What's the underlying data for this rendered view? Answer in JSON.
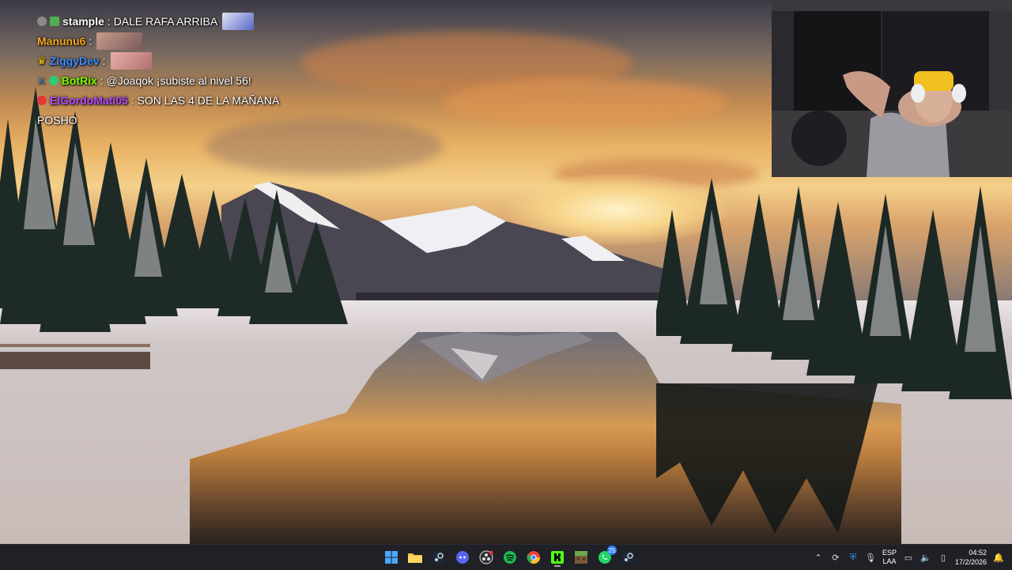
{
  "chat": {
    "messages": [
      {
        "user": "stample",
        "user_color": "#ffffff",
        "text": ": DALE RAFA ARRIBA",
        "badges": [
          "#8a8a8a",
          "#4caf50"
        ],
        "emote_colors": [
          "#5a66c8",
          "#dfe5f4"
        ]
      },
      {
        "user": "Manunu6",
        "user_color": "#f5a623",
        "text": ":",
        "badges": [],
        "emote_colors": [
          "#7a5c5c",
          "#c99a8a"
        ]
      },
      {
        "user": "ZiggyDev",
        "user_color": "#3c8cff",
        "text": ":",
        "badges": [
          "#f5c518"
        ],
        "emote_colors": [
          "#e8b0a8",
          "#b07070"
        ]
      },
      {
        "user": "BotRix",
        "user_color": "#7cfc00",
        "text": ": @Joaqok ¡subiste al nivel 56!",
        "badges": [
          "#2196f3",
          "#2ecc71"
        ],
        "emote_colors": []
      },
      {
        "user": "ElGordoMati05",
        "user_color": "#b24cff",
        "text": ": SON LAS 4 DE LA MAÑANA",
        "badges": [
          "#e53935"
        ],
        "emote_colors": []
      },
      {
        "user": "",
        "user_color": "#ffffff",
        "text": "POSHO",
        "badges": [],
        "emote_colors": []
      }
    ]
  },
  "taskbar": {
    "apps": [
      {
        "name": "start-button",
        "icon": "windows-icon",
        "color": "#4aa8ff"
      },
      {
        "name": "file-explorer",
        "icon": "folder-icon",
        "color": "#f5c242"
      },
      {
        "name": "steam",
        "icon": "steam-icon",
        "color": "#c7d5e0"
      },
      {
        "name": "discord",
        "icon": "discord-icon",
        "color": "#7289da"
      },
      {
        "name": "obs",
        "icon": "obs-icon",
        "color": "#dddddd"
      },
      {
        "name": "spotify",
        "icon": "spotify-icon",
        "color": "#1db954"
      },
      {
        "name": "chrome",
        "icon": "chrome-icon",
        "color": "#e8453c"
      },
      {
        "name": "kick",
        "icon": "kick-icon",
        "color": "#53fc18"
      },
      {
        "name": "minecraft",
        "icon": "minecraft-icon",
        "color": "#7a9a4a"
      },
      {
        "name": "whatsapp",
        "icon": "whatsapp-icon",
        "color": "#25d366",
        "badge": "25"
      },
      {
        "name": "steam-2",
        "icon": "steam-icon",
        "color": "#c7d5e0"
      }
    ],
    "tray": {
      "lang_top": "ESP",
      "lang_bottom": "LAA",
      "time": "04:52",
      "date": "17/2/2026"
    }
  }
}
